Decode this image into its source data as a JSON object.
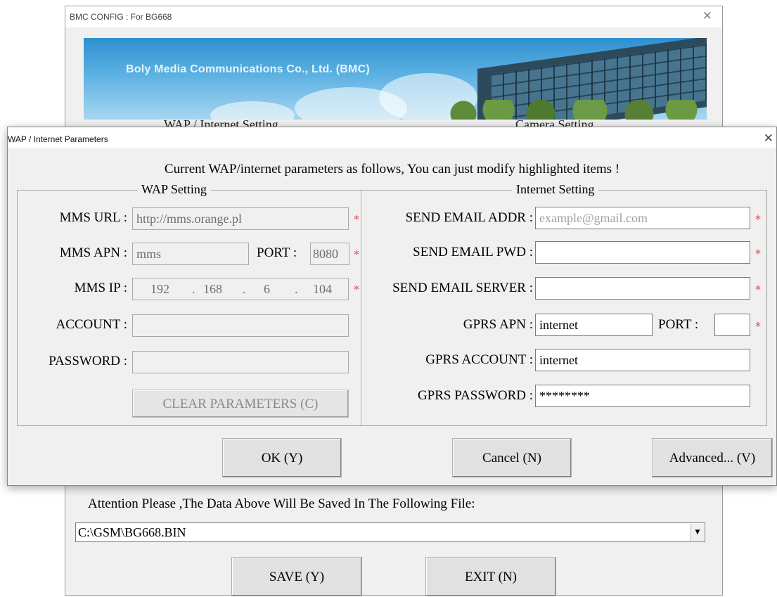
{
  "main_window": {
    "title": "BMC CONFIG : For BG668",
    "close_glyph": "✕",
    "banner_text": "Boly Media Communications Co., Ltd. (BMC)",
    "heading_left": "WAP / Internet Setting",
    "heading_right": "Camera Setting",
    "attention_text": "Attention Please ,The Data Above Will Be Saved In The Following  File:",
    "file_path": "C:\\GSM\\BG668.BIN",
    "save_label": "SAVE (Y)",
    "exit_label": "EXIT (N)"
  },
  "dialog": {
    "title": "WAP / Internet Parameters",
    "close_glyph": "✕",
    "header": "Current WAP/internet parameters as follows, You can just modify highlighted items !",
    "required_marker": "*",
    "wap": {
      "legend": "WAP Setting",
      "mms_url_label": "MMS URL :",
      "mms_url": "http://mms.orange.pl",
      "mms_apn_label": "MMS APN :",
      "mms_apn": "mms",
      "port_label": "PORT :",
      "port": "8080",
      "mms_ip_label": "MMS IP :",
      "ip": [
        "192",
        "168",
        "6",
        "104"
      ],
      "ip_dot": ".",
      "account_label": "ACCOUNT :",
      "account": "",
      "password_label": "PASSWORD :",
      "password": "",
      "clear_label": "CLEAR PARAMETERS (C)"
    },
    "internet": {
      "legend": "Internet Setting",
      "send_email_addr_label": "SEND EMAIL ADDR :",
      "send_email_addr_placeholder": "example@gmail.com",
      "send_email_pwd_label": "SEND EMAIL PWD :",
      "send_email_pwd": "",
      "send_email_server_label": "SEND EMAIL SERVER :",
      "send_email_server": "",
      "gprs_apn_label": "GPRS APN :",
      "gprs_apn": "internet",
      "port_label": "PORT :",
      "port": "",
      "gprs_account_label": "GPRS ACCOUNT :",
      "gprs_account": "internet",
      "gprs_password_label": "GPRS PASSWORD :",
      "gprs_password": "********"
    },
    "ok_label": "OK (Y)",
    "cancel_label": "Cancel (N)",
    "advanced_label": "Advanced... (V)"
  },
  "colors": {
    "required_marker": "#e04a4a",
    "disabled_text": "#6d6d6d",
    "window_bg": "#f0f0f0"
  }
}
